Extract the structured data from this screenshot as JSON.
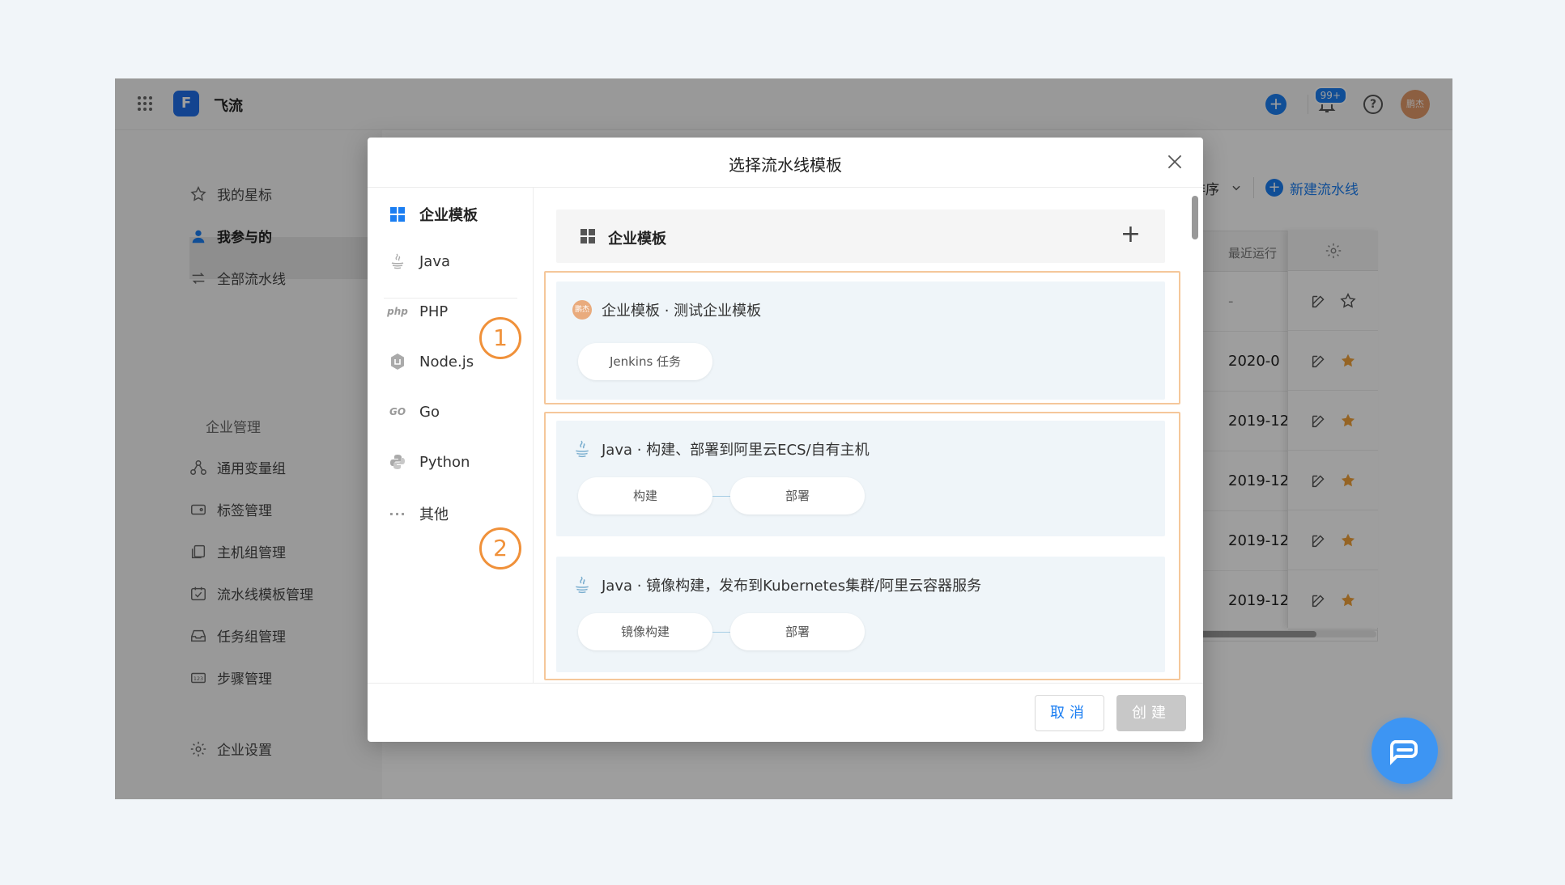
{
  "app": {
    "title": "飞流",
    "logo_letter": "F",
    "notification_badge": "99+",
    "user_avatar": "鹏杰"
  },
  "sidebar": {
    "items": [
      {
        "label": "我的星标"
      },
      {
        "label": "我参与的"
      },
      {
        "label": "全部流水线"
      }
    ],
    "group_title": "企业管理",
    "admin_items": [
      {
        "label": "通用变量组"
      },
      {
        "label": "标签管理"
      },
      {
        "label": "主机组管理"
      },
      {
        "label": "流水线模板管理"
      },
      {
        "label": "任务组管理"
      },
      {
        "label": "步骤管理"
      }
    ],
    "settings_label": "企业设置"
  },
  "background": {
    "sort_label": "排序",
    "new_pipeline_label": "新建流水线",
    "column_header": "最近运行",
    "rows": [
      "-",
      "2020-0",
      "2019-12",
      "2019-12",
      "2019-12",
      "2019-12"
    ]
  },
  "modal": {
    "title": "选择流水线模板",
    "categories": [
      {
        "label": "企业模板",
        "icon": "grid-icon"
      },
      {
        "label": "Java",
        "icon": "java-icon"
      },
      {
        "label": "PHP",
        "icon": "php-icon"
      },
      {
        "label": "Node.js",
        "icon": "nodejs-icon"
      },
      {
        "label": "Go",
        "icon": "go-icon"
      },
      {
        "label": "Python",
        "icon": "python-icon"
      },
      {
        "label": "其他",
        "icon": "more-icon"
      }
    ],
    "group_title": "企业模板",
    "templates": [
      {
        "title": "企业模板 · 测试企业模板",
        "avatar": "鹏杰",
        "stages": [
          "Jenkins 任务"
        ]
      },
      {
        "title": "Java · 构建、部署到阿里云ECS/自有主机",
        "stages": [
          "构建",
          "部署"
        ]
      },
      {
        "title": "Java · 镜像构建，发布到Kubernetes集群/阿里云容器服务",
        "stages": [
          "镜像构建",
          "部署"
        ]
      }
    ],
    "annotations": [
      "1",
      "2"
    ],
    "cancel_label": "取消",
    "create_label": "创建"
  },
  "colors": {
    "accent": "#1b7ef2",
    "highlight": "#f5c79a",
    "annotation": "#f0913a",
    "star": "#f0a23b"
  }
}
